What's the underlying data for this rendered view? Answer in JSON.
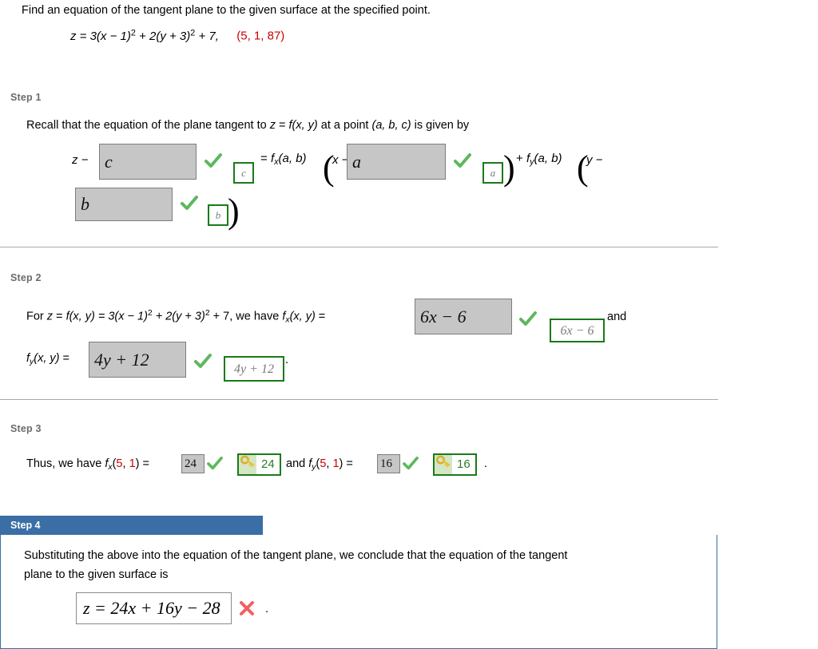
{
  "prompt": {
    "text": "Find an equation of the tangent plane to the given surface at the specified point.",
    "equation_prefix": "z = 3(x − 1)",
    "equation_mid": " + 2(y + 3)",
    "equation_tail": " + 7,",
    "exp": "2",
    "point_open": "(",
    "point_x": "5",
    "point_sep1": ", ",
    "point_y": "1",
    "point_sep2": ", ",
    "point_z": "87",
    "point_close": ")",
    "point_color": "#cc0000"
  },
  "steps": [
    {
      "label": "Step 1",
      "intro_a": "Recall that the equation of the plane tangent to ",
      "intro_z": "z",
      "intro_b": " = ",
      "intro_f": "f",
      "intro_fargs": "(x, y)",
      "intro_c": " at a point ",
      "intro_point": "(a, b, c)",
      "intro_d": " is given by",
      "lead": "z −",
      "box1_value": "c",
      "ans1_value": "c",
      "eq_sign": "= ",
      "fx_name": "f",
      "fx_sub": "x",
      "fx_args": "(a, b)",
      "x_minus": "x −",
      "box2_value": "a",
      "ans2_value": "a",
      "plus": "+ ",
      "fy_name": "f",
      "fy_sub": "y",
      "fy_args": "(a, b)",
      "y_minus": "y −",
      "box3_value": "b",
      "ans3_value": "b",
      "period": "."
    },
    {
      "label": "Step 2",
      "line1_pre": "For ",
      "line1_z": "z",
      "line1_eq1": " = ",
      "line1_f": "f",
      "line1_fargs": "(x, y)",
      "line1_eq2": " = 3(x − 1)",
      "line1_mid": " + 2(y + 3)",
      "line1_tail": " + 7, we have ",
      "line1_fx": "f",
      "line1_fx_sub": "x",
      "line1_fx_args": "(x, y)",
      "line1_eq3": " = ",
      "exp": "2",
      "box_fx_value": "6x − 6",
      "ans_fx_value": "6x − 6",
      "and_word": "and",
      "line2_fy": "f",
      "line2_fy_sub": "y",
      "line2_fy_args": "(x, y)",
      "line2_eq": " = ",
      "box_fy_value": "4y + 12",
      "ans_fy_value": "4y + 12",
      "period": "."
    },
    {
      "label": "Step 3",
      "pre": "Thus, we have ",
      "fx_name": "f",
      "fx_sub": "x",
      "fx_open": "(",
      "fx_a": "5",
      "fx_comma": ", ",
      "fx_b": "1",
      "fx_close": ")",
      "eq1": " = ",
      "box_fx_value": "24",
      "key_fx_value": "24",
      "and_word": "and ",
      "fy_name": "f",
      "fy_sub": "y",
      "fy_open": "(",
      "fy_a": "5",
      "fy_comma": ", ",
      "fy_b": "1",
      "fy_close": ")",
      "eq2": " = ",
      "box_fy_value": "16",
      "key_fy_value": "16",
      "period": ".",
      "arg_color": "#cc0000"
    },
    {
      "label": "Step 4",
      "body_line1": "Substituting the above into the equation of the tangent plane, we conclude that the equation of the tangent",
      "body_line2": "plane to the given surface is",
      "answer_value": "z = 24x + 16y − 28",
      "status": "incorrect",
      "period": ".",
      "tab_color": "#3a6ea5"
    }
  ],
  "colors": {
    "check_green": "#5cb85c",
    "answer_border_green": "#1a7a1a",
    "x_red": "#f2615f",
    "gray_box_fill": "#c6c6c6",
    "gray_box_border": "#7d7d7d",
    "step_label_gray": "#6b6b6b",
    "divider_gray": "#a9a9a9",
    "key_gold": "#e8c33c"
  }
}
